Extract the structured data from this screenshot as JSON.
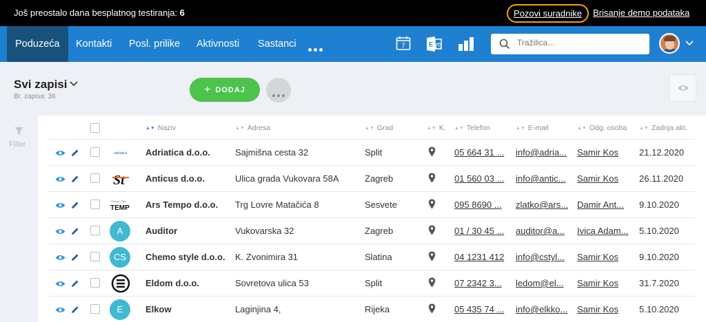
{
  "trial_bar": {
    "message": "Još preostalo dana besplatnog testiranja:",
    "days": "6",
    "invite_link": "Pozovi suradnike",
    "delete_link": "Brisanje demo podataka"
  },
  "nav": {
    "tabs": [
      {
        "label": "Poduzeća",
        "active": true
      },
      {
        "label": "Kontakti"
      },
      {
        "label": "Posl. prilike"
      },
      {
        "label": "Aktivnosti"
      },
      {
        "label": "Sastanci"
      }
    ],
    "calendar_day": "7",
    "search_placeholder": "Tražilica..."
  },
  "records": {
    "title": "Svi zapisi",
    "count_label": "Br. zapisa: 36",
    "add_button": "DODAJ"
  },
  "filter": {
    "label": "Filter"
  },
  "table": {
    "columns": [
      "Naziv",
      "Adresa",
      "Grad",
      "K.",
      "Telefon",
      "E-mail",
      "Odg. osoba",
      "Zadnja akt."
    ],
    "rows": [
      {
        "logo": "adriatica-logo",
        "initials": "",
        "name": "Adriatica d.o.o.",
        "address": "Sajmišna cesta 32",
        "city": "Split",
        "phone": "05 664 31 ...",
        "email": "info@adria...",
        "contact": "Samir Kos",
        "date": "21.12.2020"
      },
      {
        "logo": "anticus-logo",
        "initials": "",
        "name": "Anticus d.o.o.",
        "address": "Ulica grada Vukovara 58A",
        "city": "Zagreb",
        "phone": "01 560 03 ...",
        "email": "info@antic...",
        "contact": "Samir Kos",
        "date": "26.11.2020"
      },
      {
        "logo": "arstempo-logo",
        "initials": "",
        "name": "Ars Tempo d.o.o.",
        "address": "Trg Lovre Matačića 8",
        "city": "Sesvete",
        "phone": "095 8690 ...",
        "email": "zlatko@ars...",
        "contact": "Damir Ant...",
        "date": "9.10.2020"
      },
      {
        "logo": "",
        "initials": "A",
        "name": "Auditor",
        "address": "Vukovarska 32",
        "city": "Zagreb",
        "phone": "01 / 30 45 ...",
        "email": "auditor@a...",
        "contact": "Ivica Adam...",
        "date": "5.10.2020"
      },
      {
        "logo": "",
        "initials": "CS",
        "name": "Chemo style d.o.o.",
        "address": "K. Zvonimira 31",
        "city": "Slatina",
        "phone": "04 1231 412",
        "email": "info@cstyl...",
        "contact": "Samir Kos",
        "date": "9.10.2020"
      },
      {
        "logo": "eldom-logo",
        "initials": "",
        "name": "Eldom d.o.o.",
        "address": "Sovretova ulica 53",
        "city": "Split",
        "phone": "07 2342 3...",
        "email": "ledom@el...",
        "contact": "Samir Kos",
        "date": "31.7.2020"
      },
      {
        "logo": "",
        "initials": "E",
        "name": "Elkow",
        "address": "Laginjina 4,",
        "city": "Rijeka",
        "phone": "05 435 74 ...",
        "email": "info@elkko...",
        "contact": "Samir Kos",
        "date": "5.10.2020"
      }
    ]
  },
  "colors": {
    "accent": "#1f7fd0",
    "nav_active": "#17527d",
    "add_green": "#4cc34b",
    "invite_outline": "#f0a500",
    "initials_teal": "#3fbad0"
  }
}
